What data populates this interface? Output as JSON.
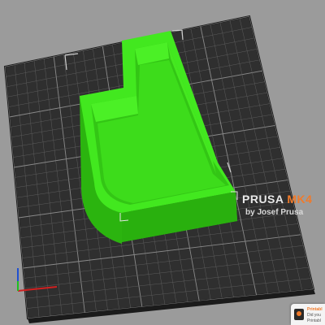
{
  "bed": {
    "brand": "PRUSA",
    "model": "MK4",
    "subtitle": "by Josef Prusa"
  },
  "notification": {
    "title": "Printabl",
    "line1": "Did you",
    "line2": "Printabl"
  },
  "colors": {
    "background": "#9b9b9b",
    "bed": "#2f2f2f",
    "grid": "#6a6a6a",
    "model": "#39e019",
    "accent": "#f07a2a"
  },
  "icons": {
    "axis": "axis-gizmo-icon",
    "notification_logo": "printables-logo-icon"
  }
}
